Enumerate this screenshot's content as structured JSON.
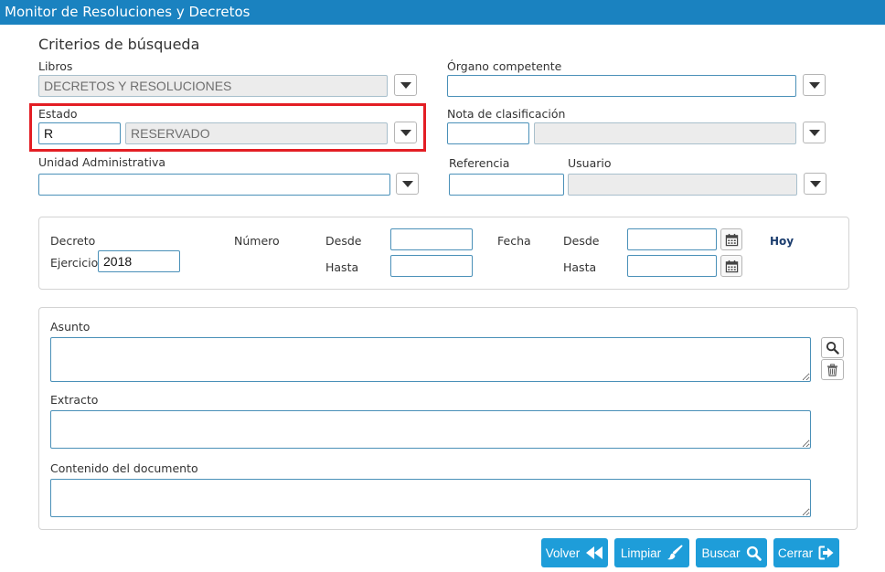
{
  "window": {
    "title": "Monitor de Resoluciones y Decretos"
  },
  "criteria": {
    "heading": "Criterios de búsqueda",
    "libros": {
      "label": "Libros",
      "value": "DECRETOS Y RESOLUCIONES"
    },
    "organo": {
      "label": "Órgano competente",
      "value": ""
    },
    "estado": {
      "label": "Estado",
      "code": "R",
      "description": "RESERVADO"
    },
    "nota": {
      "label": "Nota de clasificación",
      "code": "",
      "description": ""
    },
    "unidad": {
      "label": "Unidad Administrativa",
      "value": ""
    },
    "referencia": {
      "label": "Referencia",
      "value": ""
    },
    "usuario": {
      "label": "Usuario",
      "value": ""
    }
  },
  "decreto": {
    "title": "Decreto",
    "ejercicio_label": "Ejercicio",
    "ejercicio_value": "2018",
    "numero_label": "Número",
    "fecha_label": "Fecha",
    "desde_label": "Desde",
    "hasta_label": "Hasta",
    "hoy": "Hoy"
  },
  "text_search": {
    "asunto_label": "Asunto",
    "extracto_label": "Extracto",
    "contenido_label": "Contenido del documento"
  },
  "actions": {
    "volver": "Volver",
    "limpiar": "Limpiar",
    "buscar": "Buscar",
    "cerrar": "Cerrar"
  },
  "icons": {
    "dropdown": "caret-down-icon",
    "calendar": "calendar-icon",
    "search": "search-icon",
    "trash": "trash-icon",
    "back": "double-chevron-left-icon",
    "brush": "brush-icon",
    "exit": "sign-out-icon"
  },
  "colors": {
    "titlebar": "#1a82c0",
    "button": "#1e9dd9",
    "highlight": "#e31e24",
    "input_border": "#4a90b8",
    "readonly_bg": "#ececec",
    "hoy_link": "#1b3d6e"
  }
}
